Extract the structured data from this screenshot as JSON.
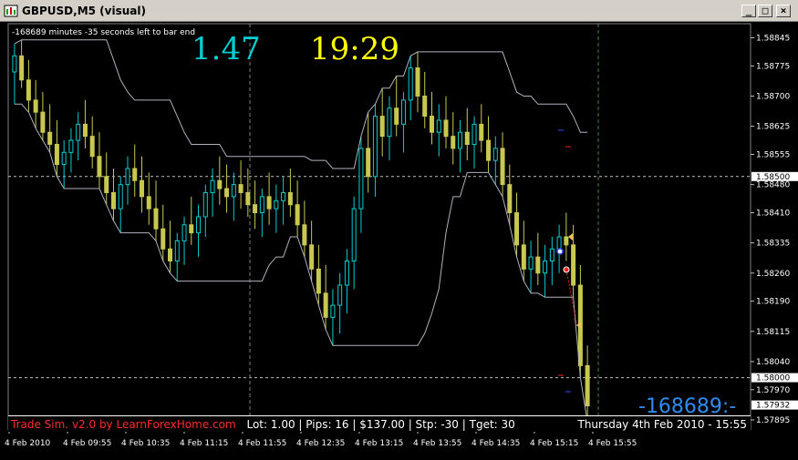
{
  "window": {
    "title": "GBPUSD,M5 (visual)",
    "min_glyph": "_",
    "max_glyph": "□",
    "close_glyph": "×"
  },
  "chart_info": {
    "bar_end_text": "-168689 minutes -35 seconds left to bar end",
    "big_left_value": "1.47",
    "big_right_value": "19:29",
    "countdown": "-168689:-"
  },
  "sim_bar": {
    "name": "Trade Sim. v2.0 by LearnForexHome.com",
    "lot": "Lot: 1.00",
    "pips": "Pips: 16",
    "profit": "$137.00",
    "stop": "Stp: -30",
    "target": "Tget: 30",
    "datetime": "Thursday 4th Feb 2010 - 15:55"
  },
  "colors": {
    "background": "#000000",
    "bull_candle": "#00ced1",
    "bear_candle": "#c8c850",
    "channel_line": "#b0b0c0",
    "grid": "#c0c0c0",
    "highlight_price_bg": "#ffffff",
    "current_bid": "#ffffff",
    "countdown": "#2e8bf0"
  },
  "chart_data": {
    "type": "candlestick",
    "symbol": "GBPUSD",
    "timeframe": "M5",
    "y_ticks": [
      "1.58845",
      "1.58775",
      "1.58700",
      "1.58625",
      "1.58555",
      "1.58480",
      "1.58410",
      "1.58335",
      "1.58260",
      "1.58190",
      "1.58115",
      "1.58040",
      "1.57970",
      "1.57895"
    ],
    "highlighted_prices": [
      "1.58500",
      "1.58000",
      "1.57932"
    ],
    "x_ticks": [
      "4 Feb 2010",
      "4 Feb 09:55",
      "4 Feb 10:35",
      "4 Feb 11:15",
      "4 Feb 11:55",
      "4 Feb 12:35",
      "4 Feb 13:15",
      "4 Feb 13:55",
      "4 Feb 14:35",
      "4 Feb 15:15",
      "4 Feb 15:55"
    ],
    "ylim": [
      1.5787,
      1.5888
    ],
    "candles": [
      [
        1.5876,
        1.5883,
        1.5868,
        1.588
      ],
      [
        1.588,
        1.5884,
        1.5872,
        1.5874
      ],
      [
        1.5874,
        1.5879,
        1.5866,
        1.5869
      ],
      [
        1.5869,
        1.5874,
        1.5862,
        1.5866
      ],
      [
        1.5866,
        1.5871,
        1.5859,
        1.5861
      ],
      [
        1.5861,
        1.5868,
        1.5856,
        1.5858
      ],
      [
        1.5858,
        1.5864,
        1.585,
        1.5853
      ],
      [
        1.5853,
        1.5859,
        1.5847,
        1.5856
      ],
      [
        1.5856,
        1.5862,
        1.5851,
        1.5859
      ],
      [
        1.5859,
        1.5866,
        1.5854,
        1.5863
      ],
      [
        1.5863,
        1.5869,
        1.5857,
        1.586
      ],
      [
        1.586,
        1.5865,
        1.5852,
        1.5855
      ],
      [
        1.5855,
        1.5861,
        1.5847,
        1.585
      ],
      [
        1.585,
        1.5856,
        1.5843,
        1.5846
      ],
      [
        1.5846,
        1.5852,
        1.5839,
        1.5842
      ],
      [
        1.5842,
        1.585,
        1.5836,
        1.5848
      ],
      [
        1.5848,
        1.5855,
        1.5843,
        1.5852
      ],
      [
        1.5852,
        1.5858,
        1.5845,
        1.5849
      ],
      [
        1.5849,
        1.5855,
        1.5841,
        1.5845
      ],
      [
        1.5845,
        1.5851,
        1.5838,
        1.5842
      ],
      [
        1.5842,
        1.5849,
        1.5834,
        1.5837
      ],
      [
        1.5837,
        1.5843,
        1.5829,
        1.5832
      ],
      [
        1.5832,
        1.5839,
        1.5826,
        1.5829
      ],
      [
        1.5829,
        1.5836,
        1.5824,
        1.5834
      ],
      [
        1.5834,
        1.584,
        1.5828,
        1.5838
      ],
      [
        1.5838,
        1.5845,
        1.5833,
        1.5836
      ],
      [
        1.5836,
        1.5843,
        1.583,
        1.584
      ],
      [
        1.584,
        1.5848,
        1.5835,
        1.5846
      ],
      [
        1.5846,
        1.5852,
        1.584,
        1.5849
      ],
      [
        1.5849,
        1.5855,
        1.5843,
        1.5847
      ],
      [
        1.5847,
        1.5853,
        1.5841,
        1.5845
      ],
      [
        1.5845,
        1.5851,
        1.5839,
        1.5848
      ],
      [
        1.5848,
        1.5854,
        1.5842,
        1.5846
      ],
      [
        1.5846,
        1.5852,
        1.584,
        1.5843
      ],
      [
        1.5843,
        1.5849,
        1.5837,
        1.5841
      ],
      [
        1.5841,
        1.5847,
        1.5835,
        1.5845
      ],
      [
        1.5845,
        1.5851,
        1.5838,
        1.5842
      ],
      [
        1.5842,
        1.5848,
        1.5836,
        1.5844
      ],
      [
        1.5844,
        1.585,
        1.5838,
        1.5846
      ],
      [
        1.5846,
        1.5852,
        1.584,
        1.5843
      ],
      [
        1.5843,
        1.5849,
        1.5835,
        1.5838
      ],
      [
        1.5838,
        1.5844,
        1.583,
        1.5833
      ],
      [
        1.5833,
        1.5839,
        1.5824,
        1.5827
      ],
      [
        1.5827,
        1.5833,
        1.5818,
        1.5821
      ],
      [
        1.5821,
        1.5828,
        1.5812,
        1.5815
      ],
      [
        1.5815,
        1.5822,
        1.5808,
        1.5818
      ],
      [
        1.5818,
        1.5826,
        1.5811,
        1.5823
      ],
      [
        1.5823,
        1.5832,
        1.5816,
        1.5829
      ],
      [
        1.5829,
        1.5845,
        1.5822,
        1.5842
      ],
      [
        1.5842,
        1.586,
        1.5836,
        1.5857
      ],
      [
        1.5857,
        1.5866,
        1.5846,
        1.585
      ],
      [
        1.585,
        1.5868,
        1.5845,
        1.5865
      ],
      [
        1.5865,
        1.5872,
        1.5855,
        1.586
      ],
      [
        1.586,
        1.587,
        1.5854,
        1.5867
      ],
      [
        1.5867,
        1.5875,
        1.586,
        1.5863
      ],
      [
        1.5863,
        1.5871,
        1.5856,
        1.5869
      ],
      [
        1.5869,
        1.588,
        1.5864,
        1.5877
      ],
      [
        1.5877,
        1.5881,
        1.5866,
        1.587
      ],
      [
        1.587,
        1.5876,
        1.5862,
        1.5865
      ],
      [
        1.5865,
        1.5871,
        1.5858,
        1.5861
      ],
      [
        1.5861,
        1.5868,
        1.5855,
        1.5864
      ],
      [
        1.5864,
        1.587,
        1.5857,
        1.586
      ],
      [
        1.586,
        1.5866,
        1.5853,
        1.5857
      ],
      [
        1.5857,
        1.5864,
        1.5851,
        1.5861
      ],
      [
        1.5861,
        1.5867,
        1.5854,
        1.5858
      ],
      [
        1.5858,
        1.5865,
        1.5852,
        1.5863
      ],
      [
        1.5863,
        1.5868,
        1.5856,
        1.5859
      ],
      [
        1.5859,
        1.5865,
        1.5851,
        1.5854
      ],
      [
        1.5854,
        1.586,
        1.5848,
        1.5857
      ],
      [
        1.5857,
        1.5861,
        1.5845,
        1.5848
      ],
      [
        1.5848,
        1.5853,
        1.5838,
        1.5841
      ],
      [
        1.5841,
        1.5846,
        1.583,
        1.5833
      ],
      [
        1.5833,
        1.5839,
        1.5824,
        1.5827
      ],
      [
        1.5827,
        1.5834,
        1.5821,
        1.583
      ],
      [
        1.583,
        1.5836,
        1.5823,
        1.5826
      ],
      [
        1.5826,
        1.5833,
        1.582,
        1.5829
      ],
      [
        1.5829,
        1.5835,
        1.5823,
        1.5832
      ],
      [
        1.5832,
        1.5838,
        1.5826,
        1.5835
      ],
      [
        1.5835,
        1.5841,
        1.5829,
        1.5833
      ],
      [
        1.5833,
        1.5838,
        1.582,
        1.5823
      ],
      [
        1.5823,
        1.5828,
        1.58,
        1.5803
      ],
      [
        1.5803,
        1.5808,
        1.5789,
        1.5793
      ]
    ]
  }
}
